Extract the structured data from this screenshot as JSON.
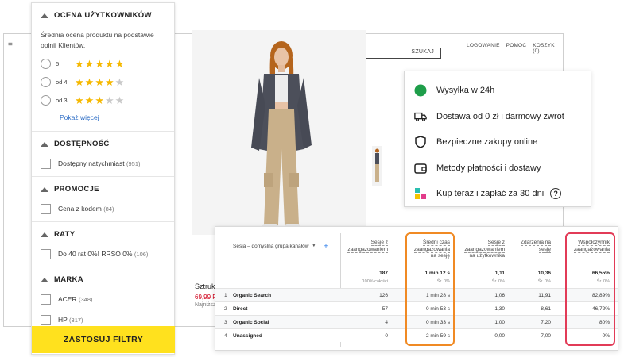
{
  "shop": {
    "search_button": "SZUKAJ",
    "links": [
      "LOGOWANIE",
      "POMOC",
      "KOSZYK (0)"
    ],
    "product_name": "Sztruk",
    "product_price": "69,99 P",
    "product_lowest": "Najniższ"
  },
  "filters": {
    "rating": {
      "title": "OCENA UŻYTKOWNIKÓW",
      "description": "Średnia ocena produktu na podstawie opinii Klientów.",
      "options": [
        {
          "label": "5",
          "stars": 5
        },
        {
          "label": "od 4",
          "stars": 4
        },
        {
          "label": "od 3",
          "stars": 3
        }
      ],
      "show_more": "Pokaż więcej"
    },
    "availability": {
      "title": "DOSTĘPNOŚĆ",
      "options": [
        {
          "label": "Dostępny natychmiast",
          "count": "(951)"
        }
      ]
    },
    "promotions": {
      "title": "PROMOCJE",
      "options": [
        {
          "label": "Cena z kodem",
          "count": "(84)"
        }
      ]
    },
    "installments": {
      "title": "RATY",
      "options": [
        {
          "label": "Do 40 rat 0%! RRSO 0%",
          "count": "(106)"
        }
      ]
    },
    "brand": {
      "title": "MARKA",
      "options": [
        {
          "label": "ACER",
          "count": "(348)"
        },
        {
          "label": "HP",
          "count": "(317)"
        }
      ]
    },
    "apply_button": "ZASTOSUJ FILTRY"
  },
  "benefits": {
    "items": [
      {
        "text": "Wysyłka w 24h",
        "icon": "green-dot-icon"
      },
      {
        "text": "Dostawa od 0 zł i darmowy zwrot",
        "icon": "truck-icon"
      },
      {
        "text": "Bezpieczne zakupy online",
        "icon": "shield-icon"
      },
      {
        "text": "Metody płatności i dostawy",
        "icon": "wallet-icon"
      },
      {
        "text": "Kup teraz i zapłać za 30 dni",
        "icon": "bnpl-blocks-icon"
      }
    ],
    "accent_color": "#1e9e4a"
  },
  "analytics": {
    "dimension": "Sesja – domyślna grupa kanałów",
    "columns": [
      {
        "header": [
          "Sesje z",
          "zaangażowaniem"
        ],
        "total": "187",
        "sub": "100% całości"
      },
      {
        "header": [
          "Średni czas",
          "zaangażowania",
          "na sesję"
        ],
        "total": "1 min 12 s",
        "sub": "Śr. 0%"
      },
      {
        "header": [
          "Sesje z",
          "zaangażowaniem",
          "na użytkownika"
        ],
        "total": "1,11",
        "sub": "Śr. 0%"
      },
      {
        "header": [
          "Zdarzenia na",
          "sesję"
        ],
        "total": "10,36",
        "sub": "Śr. 0%"
      },
      {
        "header": [
          "Współczynnik",
          "zaangażowania"
        ],
        "total": "66,55%",
        "sub": "Śr. 0%"
      }
    ],
    "rows": [
      {
        "n": "1",
        "name": "Organic Search",
        "values": [
          "126",
          "1 min 28 s",
          "1,06",
          "11,91",
          "82,89%"
        ]
      },
      {
        "n": "2",
        "name": "Direct",
        "values": [
          "57",
          "0 min 53 s",
          "1,30",
          "8,61",
          "46,72%"
        ]
      },
      {
        "n": "3",
        "name": "Organic Social",
        "values": [
          "4",
          "0 min 33 s",
          "1,00",
          "7,20",
          "80%"
        ]
      },
      {
        "n": "4",
        "name": "Unassigned",
        "values": [
          "0",
          "2 min 59 s",
          "0,00",
          "7,00",
          "0%"
        ]
      }
    ],
    "highlight_colors": [
      "#f08a24",
      "#e23b57"
    ]
  }
}
